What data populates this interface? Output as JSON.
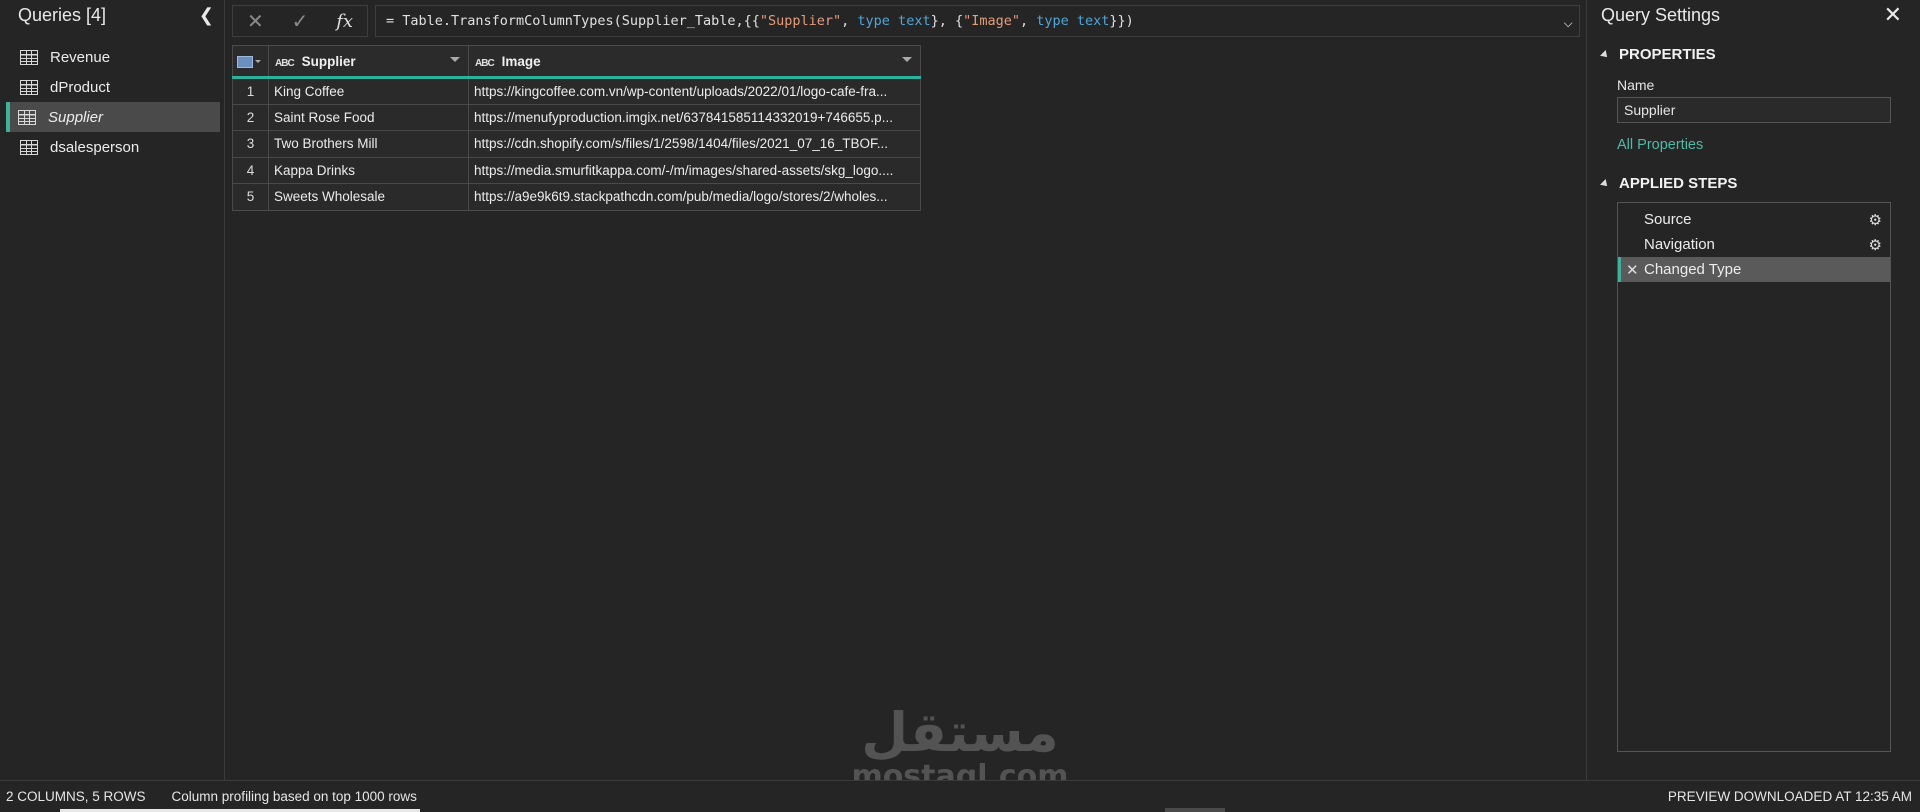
{
  "queries_pane": {
    "title": "Queries [4]",
    "collapse_icon": "chevron-left-icon",
    "items": [
      {
        "label": "Revenue",
        "icon": "table-icon",
        "active": false
      },
      {
        "label": "dProduct",
        "icon": "table-icon",
        "active": false
      },
      {
        "label": "Supplier",
        "icon": "table-icon",
        "active": true
      },
      {
        "label": "dsalesperson",
        "icon": "table-icon",
        "active": false
      }
    ]
  },
  "formula_bar": {
    "cancel_icon": "close-icon",
    "commit_icon": "check-icon",
    "fx_label": "fx",
    "formula_parts": {
      "p1": "= Table.TransformColumnTypes(Supplier_Table,{{",
      "s1": "\"Supplier\"",
      "p2": ", ",
      "k1": "type text",
      "p3": "}, {",
      "s2": "\"Image\"",
      "p4": ", ",
      "k2": "type text",
      "p5": "}})"
    },
    "formula_full": "= Table.TransformColumnTypes(Supplier_Table,{{\"Supplier\", type text}, {\"Image\", type text}})",
    "expand_icon": "chevron-down-icon"
  },
  "grid": {
    "type_icon_text": "ABC",
    "columns": [
      "Supplier",
      "Image"
    ],
    "rows": [
      {
        "n": "1",
        "supplier": "King Coffee",
        "image": "https://kingcoffee.com.vn/wp-content/uploads/2022/01/logo-cafe-fra..."
      },
      {
        "n": "2",
        "supplier": "Saint Rose Food",
        "image": "https://menufyproduction.imgix.net/637841585114332019+746655.p..."
      },
      {
        "n": "3",
        "supplier": "Two Brothers Mill",
        "image": "https://cdn.shopify.com/s/files/1/2598/1404/files/2021_07_16_TBOF..."
      },
      {
        "n": "4",
        "supplier": "Kappa Drinks",
        "image": "https://media.smurfitkappa.com/-/m/images/shared-assets/skg_logo...."
      },
      {
        "n": "5",
        "supplier": "Sweets Wholesale",
        "image": "https://a9e9k6t9.stackpathcdn.com/pub/media/logo/stores/2/wholes..."
      }
    ]
  },
  "watermark": {
    "arabic": "مستقل",
    "latin": "mostaql.com"
  },
  "query_settings": {
    "title": "Query Settings",
    "close_icon": "close-icon",
    "properties_label": "PROPERTIES",
    "name_label": "Name",
    "name_value": "Supplier",
    "all_properties": "All Properties",
    "applied_steps_label": "APPLIED STEPS",
    "steps": [
      {
        "label": "Source",
        "gear": true,
        "active": false
      },
      {
        "label": "Navigation",
        "gear": true,
        "active": false
      },
      {
        "label": "Changed Type",
        "gear": false,
        "active": true
      }
    ]
  },
  "status_bar": {
    "dimensions": "2 COLUMNS, 5 ROWS",
    "profiling": "Column profiling based on top 1000 rows",
    "preview": "PREVIEW DOWNLOADED AT 12:35 AM"
  },
  "colors": {
    "accent": "#2ab29c",
    "link": "#4fb8a6",
    "background": "#252525"
  }
}
